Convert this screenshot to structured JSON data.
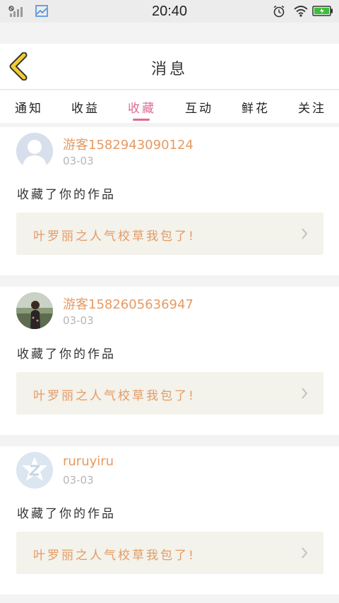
{
  "status_bar": {
    "time": "20:40",
    "icons": [
      "signal-icon",
      "image-notification-icon",
      "alarm-icon",
      "wifi-icon",
      "battery-icon"
    ]
  },
  "header": {
    "title": "消息",
    "back_icon": "chevron-left-icon"
  },
  "tabs": [
    {
      "label": "通知",
      "active": false
    },
    {
      "label": "收益",
      "active": false
    },
    {
      "label": "收藏",
      "active": true
    },
    {
      "label": "互动",
      "active": false
    },
    {
      "label": "鲜花",
      "active": false
    },
    {
      "label": "关注",
      "active": false
    }
  ],
  "items": [
    {
      "username": "游客1582943090124",
      "date": "03-03",
      "action": "收藏了你的作品",
      "work_title": "叶罗丽之人气校草我包了!",
      "avatar": "default-avatar"
    },
    {
      "username": "游客1582605636947",
      "date": "03-03",
      "action": "收藏了你的作品",
      "work_title": "叶罗丽之人气校草我包了!",
      "avatar": "photo-avatar"
    },
    {
      "username": "ruruyiru",
      "date": "03-03",
      "action": "收藏了你的作品",
      "work_title": "叶罗丽之人气校草我包了!",
      "avatar": "logo-avatar"
    }
  ],
  "colors": {
    "accent_pink": "#e06a97",
    "name_orange": "#e59a63",
    "back_yellow": "#f2cd2e",
    "work_box_bg": "#f3f2eb"
  }
}
